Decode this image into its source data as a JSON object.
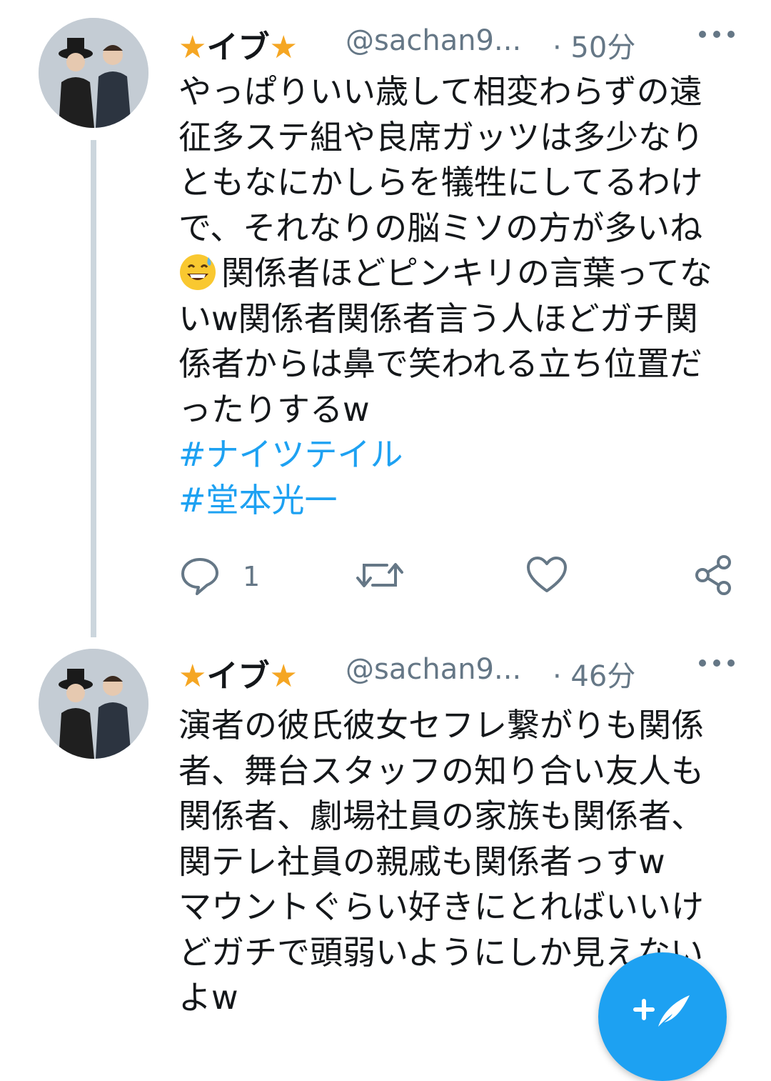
{
  "tweets": [
    {
      "display_name": "イブ",
      "handle": "@sachan9...",
      "time": "· 50分",
      "more_icon": "more-dots-icon",
      "lines_before_emoji": [
        "やっぱりいい歳して相変わらずの遠",
        "征多ステ組や良席ガッツは多少なり",
        "ともなにかしらを犠牲にしてるわけ",
        "で、それなりの脳ミソの方が多いね"
      ],
      "emoji": "grinning-sweat-emoji",
      "line_after_emoji": "関係者ほどピンキリの言葉ってな",
      "lines_after": [
        "いw関係者関係者言う人ほどガチ関",
        "係者からは鼻で笑われる立ち位置だ",
        "ったりするw"
      ],
      "hashtags": [
        "#ナイツテイル",
        "#堂本光一"
      ],
      "reply_count": "1"
    },
    {
      "display_name": "イブ",
      "handle": "@sachan9...",
      "time": "· 46分",
      "lines": [
        "演者の彼氏彼女セフレ繋がりも関係",
        "者、舞台スタッフの知り合い友人も",
        "関係者、劇場社員の家族も関係者、",
        "関テレ社員の親戚も関係者っすw",
        "マウントぐらい好きにとればいいけ",
        "どガチで頭弱いようにしか見えない",
        "よw"
      ]
    }
  ],
  "colors": {
    "text": "#14171a",
    "secondary": "#657786",
    "link": "#1da1f2",
    "star": "#f5a623",
    "thread_line": "#ccd6dd"
  },
  "icons": {
    "reply": "reply-bubble-icon",
    "retweet": "retweet-icon",
    "like": "heart-icon",
    "share": "share-icon",
    "compose": "compose-tweet-icon"
  }
}
